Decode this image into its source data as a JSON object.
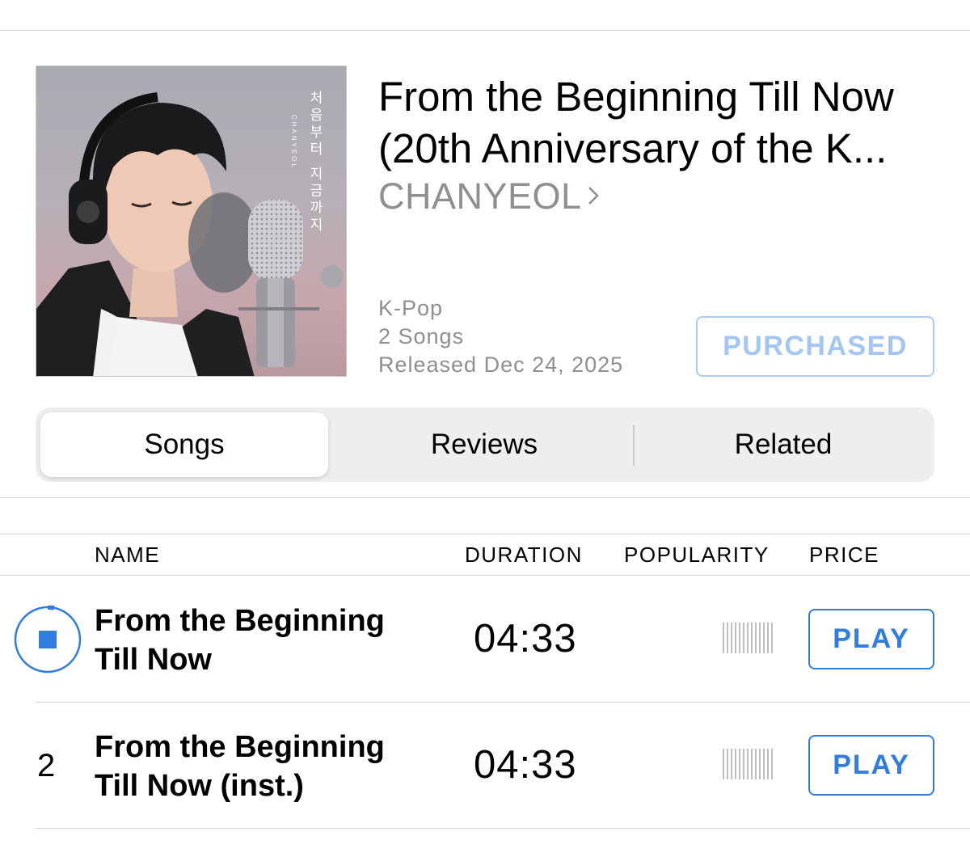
{
  "album": {
    "title_line1": "From the Beginning Till Now",
    "title_line2": "(20th Anniversary of the K...",
    "artist": "CHANYEOL",
    "genre": "K-Pop",
    "song_count": "2 Songs",
    "released": "Released Dec 24, 2025",
    "purchase_label": "PURCHASED",
    "cover_text_korean": "처음부터 지금까지",
    "cover_text_sub": "CHANYEOL"
  },
  "tabs": [
    {
      "label": "Songs",
      "active": true
    },
    {
      "label": "Reviews",
      "active": false
    },
    {
      "label": "Related",
      "active": false
    }
  ],
  "table": {
    "headers": {
      "name": "NAME",
      "duration": "DURATION",
      "popularity": "POPULARITY",
      "price": "PRICE"
    },
    "rows": [
      {
        "number": "",
        "playing": true,
        "name_line1": "From the Beginning",
        "name_line2": "Till Now",
        "duration": "04:33",
        "action": "PLAY"
      },
      {
        "number": "2",
        "playing": false,
        "name_line1": "From the Beginning",
        "name_line2": "Till Now (inst.)",
        "duration": "04:33",
        "action": "PLAY"
      }
    ]
  },
  "colors": {
    "accent": "#2f7de1",
    "accent_faded": "#a3c6f4",
    "secondary_text": "#8e8e93"
  },
  "icons": {
    "artist_link": "chevron-right-icon",
    "now_playing": "stop-progress-icon"
  }
}
